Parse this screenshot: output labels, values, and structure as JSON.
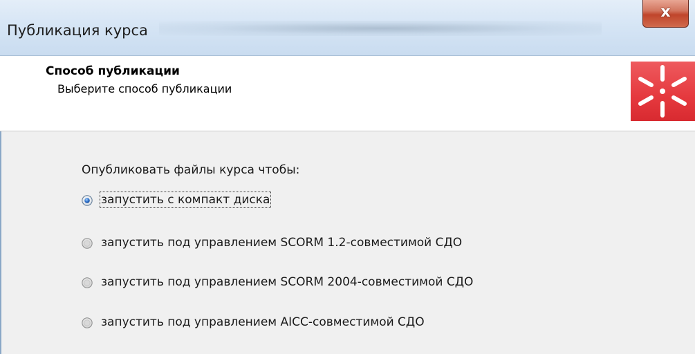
{
  "window": {
    "title": "Публикация курса",
    "close_label": "x"
  },
  "header": {
    "title": "Способ публикации",
    "subtitle": "Выберите способ публикации",
    "logo_icon": "red-starburst-logo-icon",
    "logo_color": "#e5393e"
  },
  "content": {
    "prompt": "Опубликовать файлы курса чтобы:",
    "options": [
      {
        "label": "запустить с компакт диска",
        "selected": true
      },
      {
        "label": "запустить под управлением SCORM 1.2-совместимой СДО",
        "selected": false
      },
      {
        "label": "запустить под управлением SCORM 2004-совместимой СДО",
        "selected": false
      },
      {
        "label": "запустить под управлением AICC-совместимой СДО",
        "selected": false
      }
    ]
  },
  "colors": {
    "accent": "#3a7bd5",
    "background": "#f0f0f0",
    "close_button": "#c0452b"
  }
}
